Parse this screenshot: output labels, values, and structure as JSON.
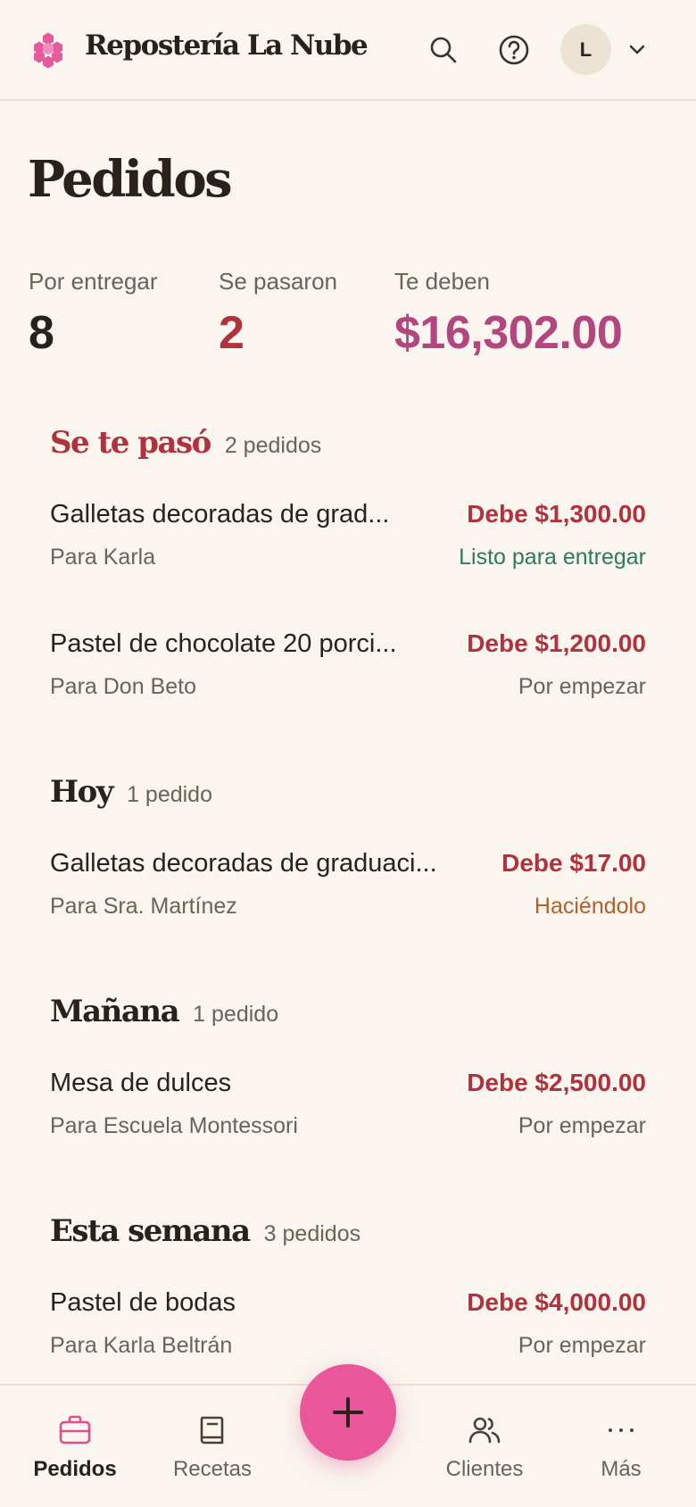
{
  "header": {
    "app_title": "Repostería La Nube",
    "avatar_initial": "L"
  },
  "page": {
    "title": "Pedidos"
  },
  "stats": [
    {
      "label": "Por entregar",
      "value": "8",
      "color": "#2a211b"
    },
    {
      "label": "Se pasaron",
      "value": "2",
      "color": "#b0323c"
    },
    {
      "label": "Te deben",
      "value": "$16,302.00",
      "color": "#b3467f"
    }
  ],
  "groups": [
    {
      "title": "Se te pasó",
      "count": "2 pedidos",
      "title_color": "#b0323c",
      "orders": [
        {
          "name": "Galletas decoradas de grad...",
          "client": "Para Karla",
          "due": "Debe $1,300.00",
          "status": "Listo para entregar",
          "status_color": "#2d7a5b"
        },
        {
          "name": "Pastel de chocolate 20 porci...",
          "client": "Para Don Beto",
          "due": "Debe $1,200.00",
          "status": "Por empezar",
          "status_color": "#6c625a"
        }
      ]
    },
    {
      "title": "Hoy",
      "count": "1 pedido",
      "title_color": "#2a211b",
      "orders": [
        {
          "name": "Galletas decoradas de graduaci...",
          "client": "Para Sra. Martínez",
          "due": "Debe $17.00",
          "status": "Haciéndolo",
          "status_color": "#b0622e"
        }
      ]
    },
    {
      "title": "Mañana",
      "count": "1 pedido",
      "title_color": "#2a211b",
      "orders": [
        {
          "name": "Mesa de dulces",
          "client": "Para Escuela Montessori",
          "due": "Debe $2,500.00",
          "status": "Por empezar",
          "status_color": "#6c625a"
        }
      ]
    },
    {
      "title": "Esta semana",
      "count": "3 pedidos",
      "title_color": "#2a211b",
      "orders": [
        {
          "name": "Pastel de bodas",
          "client": "Para Karla Beltrán",
          "due": "Debe $4,000.00",
          "status": "Por empezar",
          "status_color": "#6c625a"
        }
      ]
    }
  ],
  "nav": {
    "items": [
      {
        "label": "Pedidos",
        "icon": "briefcase-icon",
        "active": true
      },
      {
        "label": "Recetas",
        "icon": "book-icon",
        "active": false
      },
      {
        "label": "Clientes",
        "icon": "users-icon",
        "active": false
      },
      {
        "label": "Más",
        "icon": "more-dots-icon",
        "active": false
      }
    ],
    "fab_icon": "plus-icon"
  },
  "colors": {
    "accent": "#e9579a",
    "background": "#faf5ee",
    "overdue": "#b0323c",
    "amount_owed": "#b3467f"
  }
}
